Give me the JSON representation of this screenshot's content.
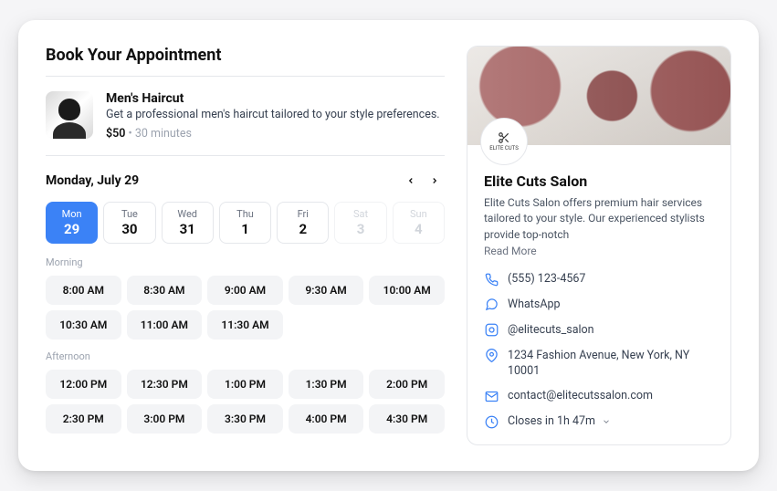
{
  "title": "Book Your Appointment",
  "service": {
    "name": "Men's Haircut",
    "description": "Get a professional men's haircut tailored to your style preferences.",
    "price": "$50",
    "separator": " • ",
    "duration": "30 minutes"
  },
  "calendar": {
    "selected_label": "Monday, July 29",
    "days": [
      {
        "dow": "Mon",
        "num": "29",
        "state": "selected"
      },
      {
        "dow": "Tue",
        "num": "30",
        "state": "normal"
      },
      {
        "dow": "Wed",
        "num": "31",
        "state": "normal"
      },
      {
        "dow": "Thu",
        "num": "1",
        "state": "normal"
      },
      {
        "dow": "Fri",
        "num": "2",
        "state": "normal"
      },
      {
        "dow": "Sat",
        "num": "3",
        "state": "disabled"
      },
      {
        "dow": "Sun",
        "num": "4",
        "state": "disabled"
      }
    ]
  },
  "slots": {
    "morning_label": "Morning",
    "morning": [
      "8:00 AM",
      "8:30 AM",
      "9:00 AM",
      "9:30 AM",
      "10:00 AM",
      "10:30 AM",
      "11:00 AM",
      "11:30 AM"
    ],
    "afternoon_label": "Afternoon",
    "afternoon": [
      "12:00 PM",
      "12:30 PM",
      "1:00 PM",
      "1:30 PM",
      "2:00 PM",
      "2:30 PM",
      "3:00 PM",
      "3:30 PM",
      "4:00 PM",
      "4:30 PM"
    ]
  },
  "salon": {
    "logo_text": "ELITE CUTS",
    "name": "Elite Cuts Salon",
    "description": "Elite Cuts Salon offers premium hair services tailored to your style. Our experienced stylists provide top-notch",
    "read_more": "Read More",
    "contacts": {
      "phone": "(555) 123-4567",
      "whatsapp": "WhatsApp",
      "instagram": "@elitecuts_salon",
      "address": "1234 Fashion Avenue, New York, NY 10001",
      "email": "contact@elitecutssalon.com",
      "hours": "Closes in 1h 47m"
    }
  }
}
